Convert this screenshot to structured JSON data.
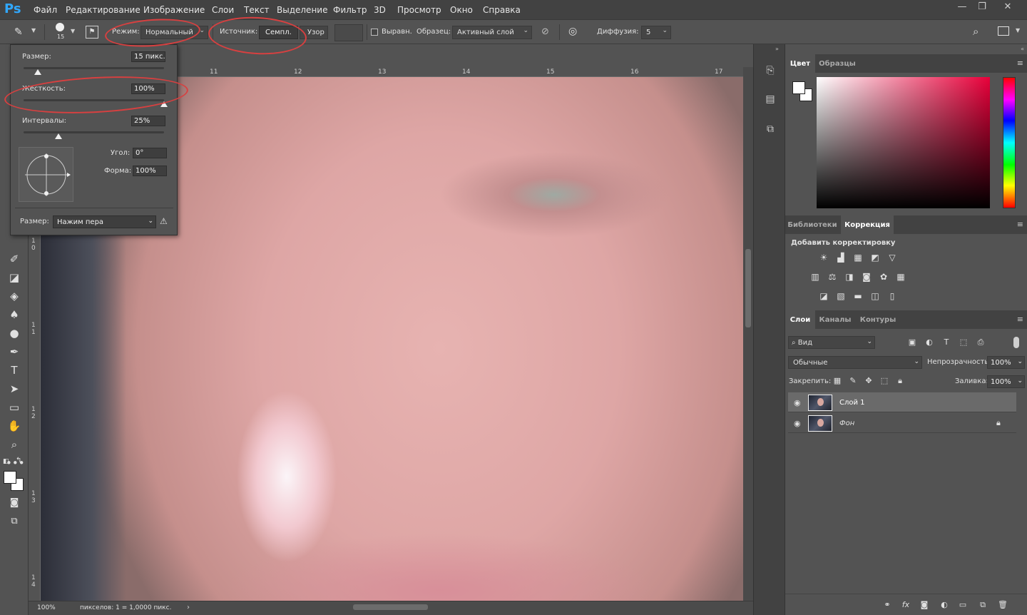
{
  "app": {
    "logo": "Ps"
  },
  "menu": [
    "Файл",
    "Редактирование",
    "Изображение",
    "Слои",
    "Текст",
    "Выделение",
    "Фильтр",
    "3D",
    "Просмотр",
    "Окно",
    "Справка"
  ],
  "window_buttons": {
    "minimize": "—",
    "restore": "❐",
    "close": "✕"
  },
  "options": {
    "brush_size": "15",
    "mode_label": "Режим:",
    "mode_value": "Нормальный",
    "source_label": "Источник:",
    "source_sampled": "Семпл.",
    "source_pattern": "Узор",
    "aligned_label": "Выравн.",
    "sample_label": "Образец:",
    "sample_value": "Активный слой",
    "diffusion_label": "Диффузия:",
    "diffusion_value": "5"
  },
  "brush_popup": {
    "size_label": "Размер:",
    "size_value": "15 пикс.",
    "hardness_label": "Жесткость:",
    "hardness_value": "100%",
    "spacing_label": "Интервалы:",
    "spacing_value": "25%",
    "angle_label": "Угол:",
    "angle_value": "0°",
    "roundness_label": "Форма:",
    "roundness_value": "100%",
    "pen_size_label": "Размер:",
    "pen_size_value": "Нажим пера",
    "size_level": 0.1,
    "hardness_level": 1.0,
    "spacing_level": 0.25
  },
  "ruler": {
    "top": [
      "11",
      "12",
      "13",
      "14",
      "15",
      "16",
      "17"
    ],
    "left": [
      "1 0",
      "1 1",
      "1 2",
      "1 3",
      "1 4"
    ]
  },
  "status": {
    "zoom": "100%",
    "info": "пикселов: 1 = 1,0000 пикс."
  },
  "panels": {
    "color_tabs": [
      "Цвет",
      "Образцы"
    ],
    "adjust_tabs": [
      "Библиотеки",
      "Коррекция"
    ],
    "adjust_title": "Добавить корректировку",
    "layer_tabs": [
      "Слои",
      "Каналы",
      "Контуры"
    ],
    "filter_kind": "Вид",
    "blend_mode": "Обычные",
    "opacity_label": "Непрозрачность:",
    "opacity_value": "100%",
    "lock_label": "Закрепить:",
    "fill_label": "Заливка:",
    "fill_value": "100%",
    "layers": [
      {
        "name": "Слой 1",
        "selected": true,
        "locked": false
      },
      {
        "name": "Фон",
        "selected": false,
        "locked": true
      }
    ]
  },
  "colors": {
    "accent_ring": "#d84040",
    "ps_blue": "#31a8ff"
  }
}
